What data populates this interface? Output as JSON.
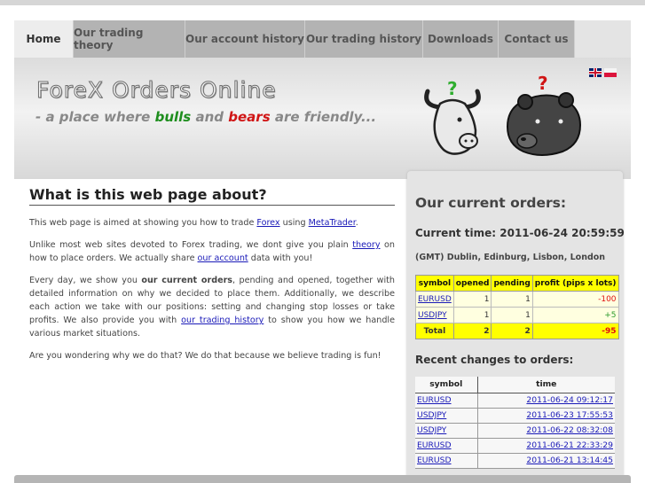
{
  "nav": {
    "tabs": [
      {
        "label": "Home"
      },
      {
        "label": "Our trading theory"
      },
      {
        "label": "Our account history"
      },
      {
        "label": "Our trading history"
      },
      {
        "label": "Downloads"
      },
      {
        "label": "Contact us"
      }
    ]
  },
  "header": {
    "logo_text": "ForeX Orders Online",
    "tagline_prefix": "- a place where",
    "tagline_bulls": "bulls",
    "tagline_and": "and",
    "tagline_bears": "bears",
    "tagline_suffix": "are friendly...",
    "bull_mark": "?",
    "bear_mark": "?"
  },
  "about": {
    "title": "What is this web page about?",
    "p1": {
      "pre": "This web page is aimed at showing you how to trade ",
      "link1": "Forex",
      "mid": " using ",
      "link2": "MetaTrader",
      "post": "."
    },
    "p2": {
      "pre": "Unlike most web sites devoted to Forex trading, we dont give you plain ",
      "link1": "theory",
      "mid": " on how to place orders. We actually share ",
      "link2": "our account",
      "post": " data with you!"
    },
    "p3": {
      "pre": "Every day, we show you ",
      "bold": "our current orders",
      "mid": ", pending and opened, together with detailed information on why we decided to place them. Additionally, we describe each action we take with our positions: setting and changing stop losses or take profits. We also provide you with ",
      "link": "our trading history",
      "post": " to show you how we handle various market situations."
    },
    "p4": "Are you wondering why we do that? We do that because we believe trading is fun!"
  },
  "orders": {
    "title": "Our current orders:",
    "time_label": "Current time: 2011-06-24 20:59:59",
    "timezone": "(GMT) Dublin, Edinburg, Lisbon, London",
    "columns": [
      "symbol",
      "opened",
      "pending",
      "profit (pips x lots)"
    ],
    "rows": [
      {
        "symbol": "EURUSD",
        "opened": "1",
        "pending": "1",
        "profit": "-100"
      },
      {
        "symbol": "USDJPY",
        "opened": "1",
        "pending": "1",
        "profit": "+5"
      }
    ],
    "total": {
      "label": "Total",
      "opened": "2",
      "pending": "2",
      "profit": "-95"
    }
  },
  "recent": {
    "title": "Recent changes to orders:",
    "columns": [
      "symbol",
      "time"
    ],
    "rows": [
      {
        "symbol": "EURUSD",
        "time": "2011-06-24 09:12:17"
      },
      {
        "symbol": "USDJPY",
        "time": "2011-06-23 17:55:53"
      },
      {
        "symbol": "USDJPY",
        "time": "2011-06-22 08:32:08"
      },
      {
        "symbol": "EURUSD",
        "time": "2011-06-21 22:33:29"
      },
      {
        "symbol": "EURUSD",
        "time": "2011-06-21 13:14:45"
      }
    ]
  },
  "colors": {
    "bulls": "#1e8e1e",
    "bears": "#d01515",
    "table_header": "#ffff00",
    "link": "#1a1ab8",
    "negative": "#e01010",
    "positive": "#2b9a2b"
  },
  "icons": [
    "uk-flag-icon",
    "poland-flag-icon",
    "bull-head-icon",
    "bear-head-icon"
  ]
}
